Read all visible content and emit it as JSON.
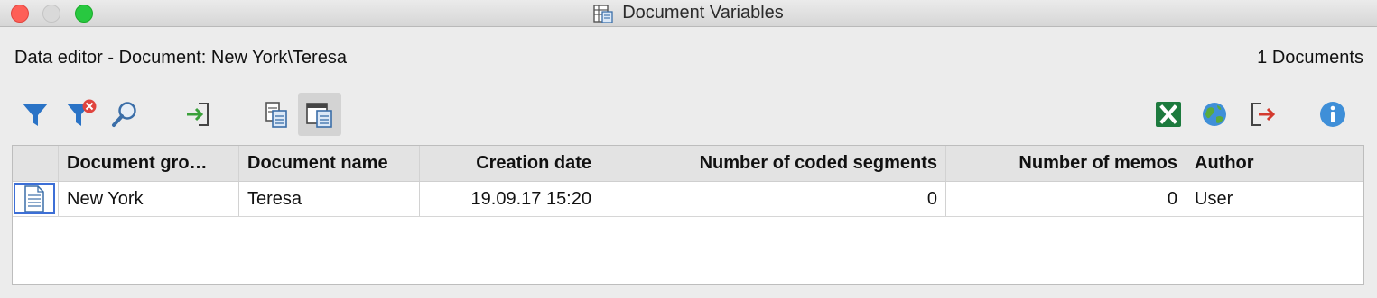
{
  "window": {
    "title": "Document Variables"
  },
  "info": {
    "editor_label": "Data editor - Document: New York\\Teresa",
    "document_count": "1 Documents"
  },
  "toolbar": {
    "buttons": [
      {
        "icon": "filter-icon"
      },
      {
        "icon": "remove-filter-icon"
      },
      {
        "icon": "search-icon"
      },
      {
        "icon": "import-icon"
      },
      {
        "icon": "document-list-icon"
      },
      {
        "icon": "document-table-icon",
        "active": true
      },
      {
        "icon": "excel-export-icon"
      },
      {
        "icon": "globe-icon"
      },
      {
        "icon": "export-icon"
      },
      {
        "icon": "info-icon"
      }
    ]
  },
  "table": {
    "columns": [
      "",
      "Document gro…",
      "Document name",
      "Creation date",
      "Number of coded segments",
      "Number of memos",
      "Author"
    ],
    "rows": [
      {
        "icon": "text-document-icon",
        "cells": [
          "New York",
          "Teresa",
          "19.09.17 15:20",
          "0",
          "0",
          "User"
        ]
      }
    ]
  },
  "colors": {
    "filter_blue": "#2a73c6",
    "remove_red": "#e0443e",
    "excel_green": "#1d7a3e",
    "info_blue": "#3f8fd8",
    "selection_border": "#3d6fd6"
  }
}
